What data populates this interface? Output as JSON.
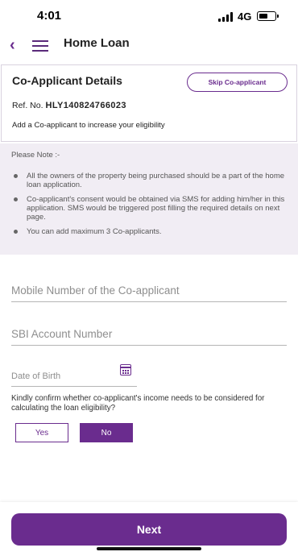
{
  "status_bar": {
    "time": "4:01",
    "network": "4G",
    "icons": [
      "signal-icon",
      "battery-icon"
    ]
  },
  "header": {
    "title": "Home Loan",
    "icons": [
      "back-arrow-icon",
      "hamburger-menu-icon"
    ]
  },
  "card": {
    "title": "Co-Applicant Details",
    "skip_label": "Skip Co-applicant",
    "ref_label": "Ref. No.",
    "ref_number": "HLY140824766023",
    "note": "Add a Co-applicant to increase your eligibility"
  },
  "note_panel": {
    "heading": "Please Note :-",
    "items": [
      "All the owners of the property being purchased should be a part of the home loan application.",
      "Co-applicant's consent would be obtained via SMS for adding him/her in this application. SMS would be triggered post filling the required details on next page.",
      "You can add maximum 3 Co-applicants."
    ]
  },
  "form": {
    "mobile_placeholder": "Mobile Number of the Co-applicant",
    "mobile_value": "",
    "account_placeholder": "SBI Account Number",
    "account_value": "",
    "dob_placeholder": "Date of Birth",
    "dob_value": "",
    "confirm_question": "Kindly confirm whether co-applicant's income needs to be considered for calculating the loan eligibility?",
    "yes_label": "Yes",
    "no_label": "No",
    "selected_option": "No"
  },
  "footer": {
    "next_label": "Next"
  },
  "colors": {
    "accent": "#6a2c8e",
    "note_background": "#f1edf4",
    "text": "#222222"
  }
}
